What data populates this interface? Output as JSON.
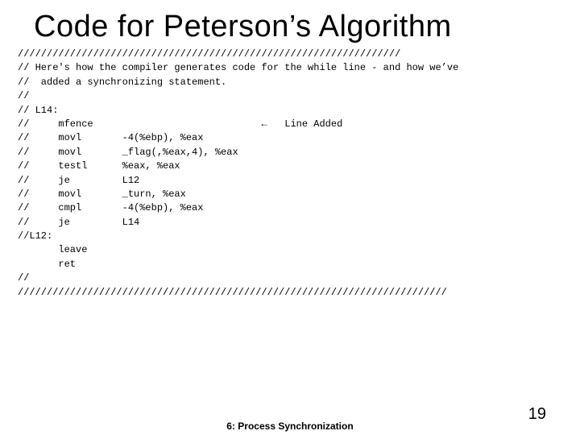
{
  "title": "Code for Peterson’s Algorithm",
  "code_lines": [
    "//////////////////////////////////////////////////////////////////",
    "// Here's how the compiler generates code for the while line - and how we’ve",
    "//  added a synchronizing statement.",
    "//",
    "// L14:",
    "//     mfence                             ←   Line Added",
    "//     movl       -4(%ebp), %eax",
    "//     movl       _flag(,%eax,4), %eax",
    "//     testl      %eax, %eax",
    "//     je         L12",
    "//     movl       _turn, %eax",
    "//     cmpl       -4(%ebp), %eax",
    "//     je         L14",
    "//L12:",
    "       leave",
    "       ret",
    "//",
    "//////////////////////////////////////////////////////////////////////////"
  ],
  "footer": {
    "center": "6: Process Synchronization",
    "page": "19"
  }
}
